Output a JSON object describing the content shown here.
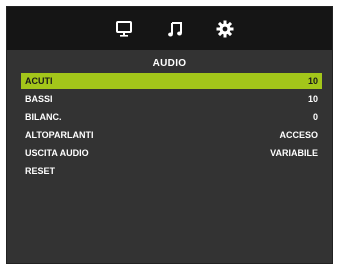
{
  "tabs": [
    {
      "icon": "monitor-icon"
    },
    {
      "icon": "music-note-icon"
    },
    {
      "icon": "gear-icon"
    }
  ],
  "menu": {
    "title": "AUDIO",
    "items": [
      {
        "label": "ACUTI",
        "value": "10",
        "selected": true
      },
      {
        "label": "BASSI",
        "value": "10"
      },
      {
        "label": "BILANC.",
        "value": "0"
      },
      {
        "label": "ALTOPARLANTI",
        "value": "ACCESO"
      },
      {
        "label": "USCITA AUDIO",
        "value": "VARIABILE"
      },
      {
        "label": "RESET",
        "value": ""
      }
    ]
  },
  "colors": {
    "highlight": "#a3c61a",
    "panel": "#333333",
    "topbar": "#151515",
    "text": "#ffffff"
  }
}
